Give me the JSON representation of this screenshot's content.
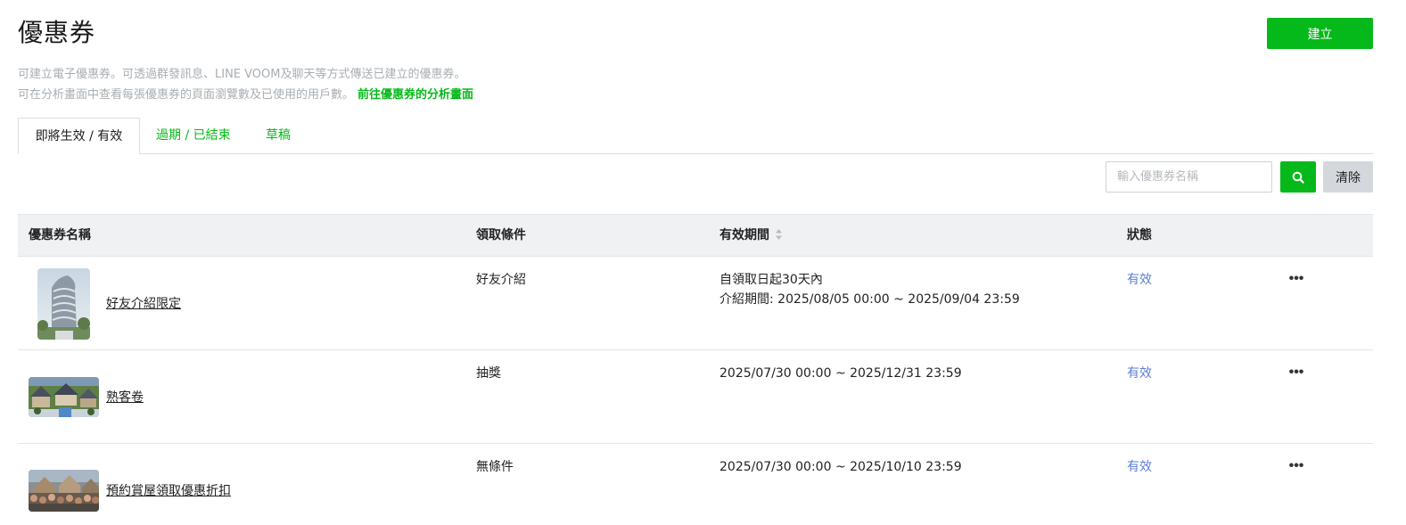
{
  "header": {
    "title": "優惠券",
    "create_label": "建立"
  },
  "description": {
    "line1": "可建立電子優惠券。可透過群發訊息、LINE VOOM及聊天等方式傳送已建立的優惠券。",
    "line2": "可在分析畫面中查看每張優惠券的頁面瀏覽數及已使用的用戶數。",
    "link": "前往優惠券的分析畫面"
  },
  "tabs": [
    {
      "label": "即將生效 / 有效",
      "active": true
    },
    {
      "label": "過期 / 已結束",
      "active": false
    },
    {
      "label": "草稿",
      "active": false
    }
  ],
  "search": {
    "placeholder": "輸入優惠券名稱",
    "clear_label": "清除",
    "icon": "search-icon"
  },
  "table": {
    "columns": [
      "優惠券名稱",
      "領取條件",
      "有效期間",
      "狀態"
    ],
    "sort_icon": "sort-icon",
    "more_icon": "more-icon",
    "rows": [
      {
        "name": "好友介紹限定",
        "condition": "好友介紹",
        "period_line1": "自領取日起30天內",
        "period_line2": "介紹期間: 2025/08/05 00:00 ~ 2025/09/04 23:59",
        "status": "有效",
        "more": "•••"
      },
      {
        "name": "熟客卷",
        "condition": "抽獎",
        "period_line1": "2025/07/30 00:00 ~ 2025/12/31 23:59",
        "period_line2": "",
        "status": "有效",
        "more": "•••"
      },
      {
        "name": "預約賞屋領取優惠折扣",
        "condition": "無條件",
        "period_line1": "2025/07/30 00:00 ~ 2025/10/10 23:59",
        "period_line2": "",
        "status": "有效",
        "more": "•••"
      }
    ]
  },
  "colors": {
    "accent": "#06b91a",
    "status": "#5b7fd4",
    "muted_text": "#a8aeb3",
    "header_bg": "#eff1f3"
  }
}
